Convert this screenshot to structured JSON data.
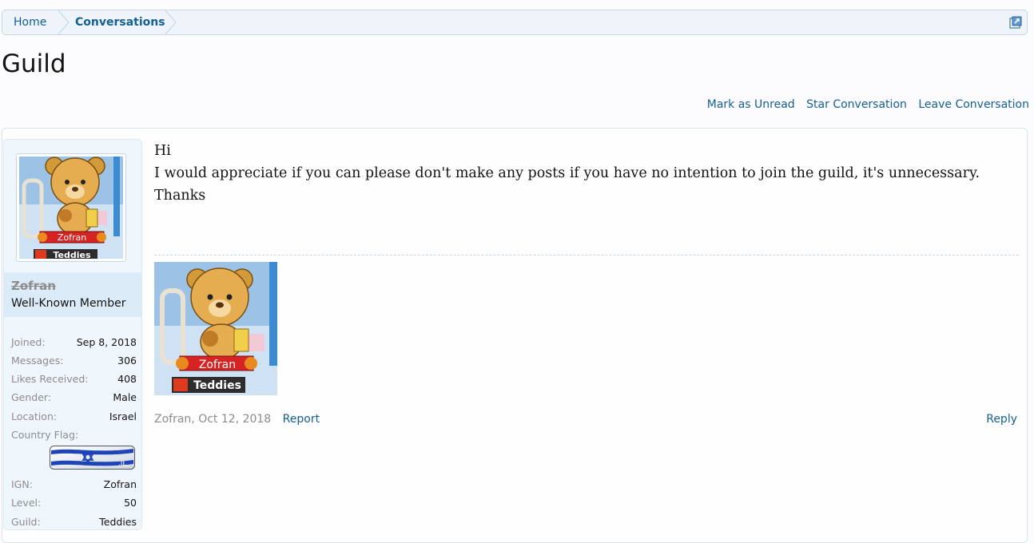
{
  "breadcrumb": {
    "home": "Home",
    "current": "Conversations"
  },
  "page": {
    "title": "Guild"
  },
  "actions": {
    "mark_unread": "Mark as Unread",
    "star": "Star Conversation",
    "leave": "Leave Conversation"
  },
  "user": {
    "name": "Zofran",
    "title": "Well-Known Member",
    "avatar_name_tag": "Zofran",
    "avatar_guild_tag": "Teddies",
    "info": [
      {
        "label": "Joined:",
        "value": "Sep 8, 2018"
      },
      {
        "label": "Messages:",
        "value": "306"
      },
      {
        "label": "Likes Received:",
        "value": "408"
      },
      {
        "label": "Gender:",
        "value": "Male"
      },
      {
        "label": "Location:",
        "value": "Israel"
      }
    ],
    "flag_label": "Country Flag:",
    "game_info": [
      {
        "label": "IGN:",
        "value": "Zofran"
      },
      {
        "label": "Level:",
        "value": "50"
      },
      {
        "label": "Guild:",
        "value": "Teddies"
      }
    ]
  },
  "message": {
    "lines": [
      "Hi",
      "I would appreciate if you can please don't make any posts if you have no intention to join the guild, it's unnecessary.",
      "Thanks"
    ],
    "signature_name_tag": "Zofran",
    "signature_guild_tag": "Teddies",
    "author_date": "Zofran, Oct 12, 2018",
    "report": "Report",
    "reply": "Reply"
  },
  "colors": {
    "link": "#176093",
    "crumb_bg": "#eef4fa",
    "userbox_bg": "#f0f7fc",
    "name_block_bg": "#dcebf8"
  }
}
